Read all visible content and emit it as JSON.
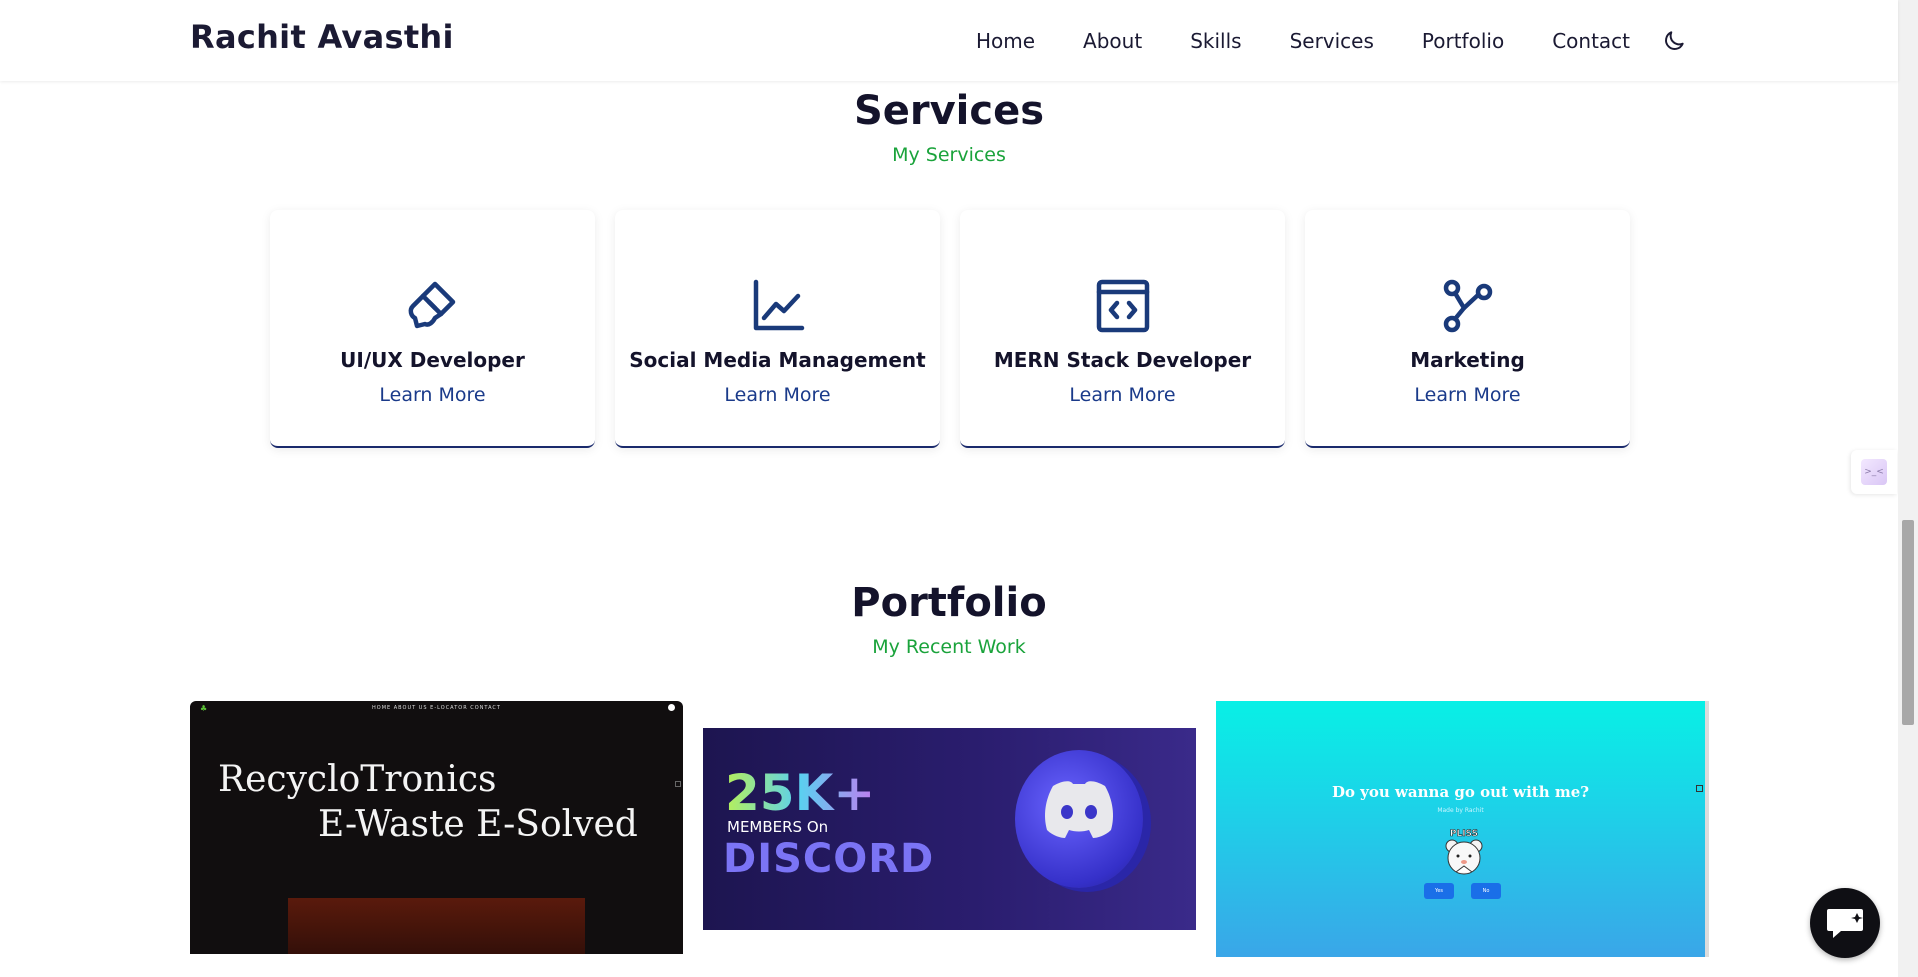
{
  "header": {
    "brand": "Rachit Avasthi",
    "nav": [
      "Home",
      "About",
      "Skills",
      "Services",
      "Portfolio",
      "Contact"
    ],
    "theme_icon": "moon-icon"
  },
  "services": {
    "title": "Services",
    "subtitle": "My Services",
    "cards": [
      {
        "title": "UI/UX Developer",
        "link": "Learn More",
        "icon": "paintbrush-icon"
      },
      {
        "title": "Social Media Management",
        "link": "Learn More",
        "icon": "line-chart-icon"
      },
      {
        "title": "MERN Stack Developer",
        "link": "Learn More",
        "icon": "code-window-icon"
      },
      {
        "title": "Marketing",
        "link": "Learn More",
        "icon": "network-nodes-icon"
      }
    ]
  },
  "portfolio": {
    "title": "Portfolio",
    "subtitle": "My Recent Work",
    "items": [
      {
        "nav_text": "HOME   ABOUT US   E-LOCATOR   CONTACT",
        "line1": "RecycloTronics",
        "line2": "E-Waste E-Solved"
      },
      {
        "big": "25K+",
        "members": "MEMBERS On",
        "discord": "DISCORD"
      },
      {
        "question": "Do you wanna go out with me?",
        "small_text": "Made by Rachit",
        "bear_text": "PLISS",
        "yes": "Yes",
        "no": "No"
      }
    ]
  },
  "widgets": {
    "side_widget_text": ">_<",
    "chat_icon": "chat-bubble-icon"
  },
  "colors": {
    "accent_green": "#1aa33b",
    "link_blue": "#1a3a8a",
    "icon_blue": "#1a3a7a",
    "heading_dark": "#14132b"
  }
}
